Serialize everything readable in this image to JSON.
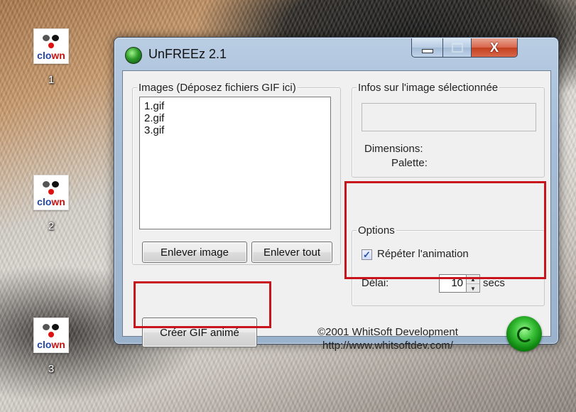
{
  "desktop": {
    "icons": [
      {
        "image_text_a": "clo",
        "image_text_b": "wn",
        "label": "1"
      },
      {
        "image_text_a": "clo",
        "image_text_b": "wn",
        "label": "2"
      },
      {
        "image_text_a": "clo",
        "image_text_b": "wn",
        "label": "3"
      }
    ]
  },
  "window": {
    "title": "UnFREEz 2.1",
    "controls": {
      "close_glyph": "X"
    },
    "images_group": {
      "label": "Images (Déposez fichiers GIF ici)",
      "files": [
        "1.gif",
        "2.gif",
        "3.gif"
      ],
      "remove_button": "Enlever image",
      "remove_all_button": "Enlever tout"
    },
    "info_group": {
      "label": "Infos sur l'image sélectionnée",
      "dimensions_label": "Dimensions:",
      "palette_label": "Palette:"
    },
    "options_group": {
      "label": "Options",
      "repeat_label": "Répéter l'animation",
      "repeat_checked": true,
      "delay_label": "Délai:",
      "delay_value": "10",
      "delay_unit": "secs"
    },
    "create_button": "Créer GIF animé",
    "copyright": "©2001 WhitSoft Development",
    "url": "http://www.whitsoftdev.com/"
  },
  "highlight_color": "#c8141d"
}
